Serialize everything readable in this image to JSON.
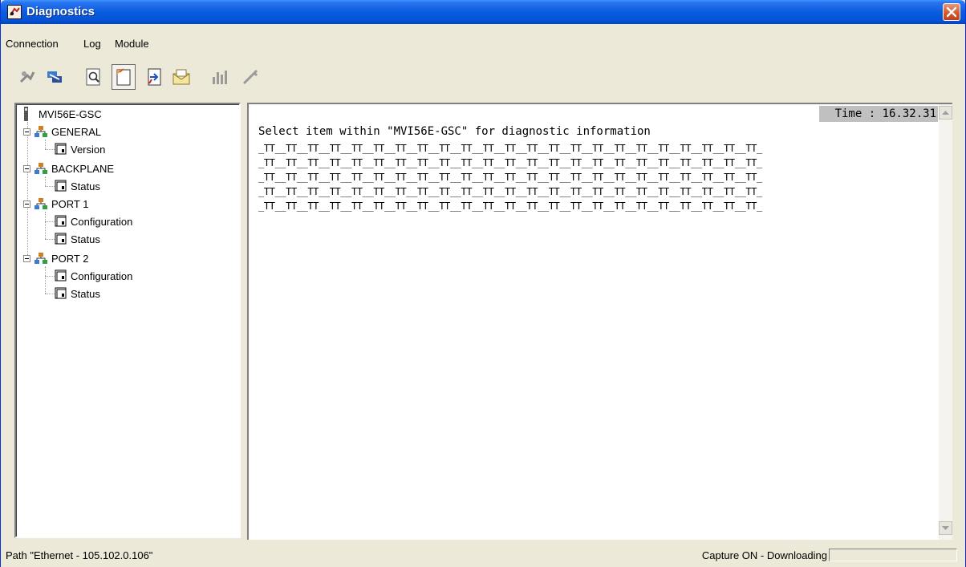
{
  "window": {
    "title": "Diagnostics"
  },
  "menu": [
    "Connection",
    "Log",
    "Module"
  ],
  "toolbar": {
    "buttons": [
      {
        "icon": "disconnect-icon",
        "enabled": false
      },
      {
        "icon": "connect-icon",
        "enabled": true
      },
      {
        "icon": "find-icon",
        "enabled": true
      },
      {
        "icon": "new-log-icon",
        "enabled": true,
        "selected": true
      },
      {
        "icon": "export-icon",
        "enabled": true
      },
      {
        "icon": "mail-icon",
        "enabled": true
      },
      {
        "icon": "chart-icon",
        "enabled": false
      },
      {
        "icon": "tools-icon",
        "enabled": false
      }
    ]
  },
  "tree": {
    "root": "MVI56E-GSC",
    "groups": [
      {
        "label": "GENERAL",
        "children": [
          "Version"
        ]
      },
      {
        "label": "BACKPLANE",
        "children": [
          "Status"
        ]
      },
      {
        "label": "PORT 1",
        "children": [
          "Configuration",
          "Status"
        ]
      },
      {
        "label": "PORT 2",
        "children": [
          "Configuration",
          "Status"
        ]
      }
    ]
  },
  "content": {
    "time": "Time : 16.32.31",
    "message": "Select item within \"MVI56E-GSC\" for diagnostic information",
    "tt_lines": [
      "_TT__TT__TT__TT__TT__TT__TT__TT__TT__TT__TT__TT__TT__TT__TT__TT__TT__TT__TT__TT__TT__TT__TT_",
      "_TT__TT__TT__TT__TT__TT__TT__TT__TT__TT__TT__TT__TT__TT__TT__TT__TT__TT__TT__TT__TT__TT__TT_",
      "_TT__TT__TT__TT__TT__TT__TT__TT__TT__TT__TT__TT__TT__TT__TT__TT__TT__TT__TT__TT__TT__TT__TT_",
      "_TT__TT__TT__TT__TT__TT__TT__TT__TT__TT__TT__TT__TT__TT__TT__TT__TT__TT__TT__TT__TT__TT__TT_",
      "_TT__TT__TT__TT__TT__TT__TT__TT__TT__TT__TT__TT__TT__TT__TT__TT__TT__TT__TT__TT__TT__TT__TT_"
    ]
  },
  "status": {
    "path": "Path \"Ethernet - 105.102.0.106\"",
    "capture": "Capture ON - Downloading"
  },
  "colors": {
    "titlebar": "#0553d4",
    "window_bg": "#ece9d8",
    "time_bg": "#c0c0c0"
  }
}
